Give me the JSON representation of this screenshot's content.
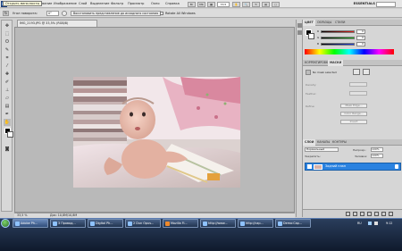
{
  "app": {
    "logo": "Ps",
    "tooltip": "Открыть мини-мосты"
  },
  "menubar": {
    "items": [
      "Файл",
      "Редактирование",
      "Изображение",
      "Слой",
      "Выделение",
      "Фильтр",
      "Просмотр",
      "Окно",
      "Справка"
    ],
    "zoom": "33,5",
    "workspace": "ESSENTIALS"
  },
  "options": {
    "angle_label": "Угол поворота:",
    "angle_value": "0°",
    "restore_button": "Восстановить представление до исходного состояния",
    "rotate_all_label": "Rotate All Windows"
  },
  "document": {
    "tab_title": "IMG_2193.JPG @ 33,5% (RGB/8)",
    "zoom_status": "33,5 %",
    "doc_status": "Док: 10,8M/10,8M"
  },
  "color_panel": {
    "tabs": [
      "ЦВЕТ",
      "ОБРАЗЦЫ",
      "СТИЛИ"
    ],
    "channels": [
      {
        "name": "R",
        "value": "0",
        "color": "#e0201a"
      },
      {
        "name": "G",
        "value": "0",
        "color": "#20b020"
      },
      {
        "name": "B",
        "value": "0",
        "color": "#2040e0"
      }
    ]
  },
  "masks_panel": {
    "tabs": [
      "КОРРЕКТИРОВКА",
      "МАСКИ"
    ],
    "status": "No mask selected",
    "fields": [
      "Density:",
      "Feather:",
      "Refine:"
    ],
    "buttons": [
      "Mask Edge...",
      "Color Range...",
      "Invert"
    ]
  },
  "layers_panel": {
    "tabs": [
      "СЛОИ",
      "КАНАЛЫ",
      "КОНТУРЫ"
    ],
    "blend_mode": "Нормальный",
    "opacity_label": "Непрозр.:",
    "opacity_value": "100%",
    "lock_label": "Закрепить:",
    "fill_label": "Заливка:",
    "fill_value": "100%",
    "layer_name": "Задний план"
  },
  "taskbar": {
    "buttons": [
      "Adobe Ph...",
      "3 Провод...",
      "Digital Ph...",
      "2 Dun Opus...",
      "Mozilla Fi...",
      "http://www...",
      "http://cap...",
      "Demo:Cap..."
    ],
    "language": "RU",
    "time": "9:12"
  }
}
